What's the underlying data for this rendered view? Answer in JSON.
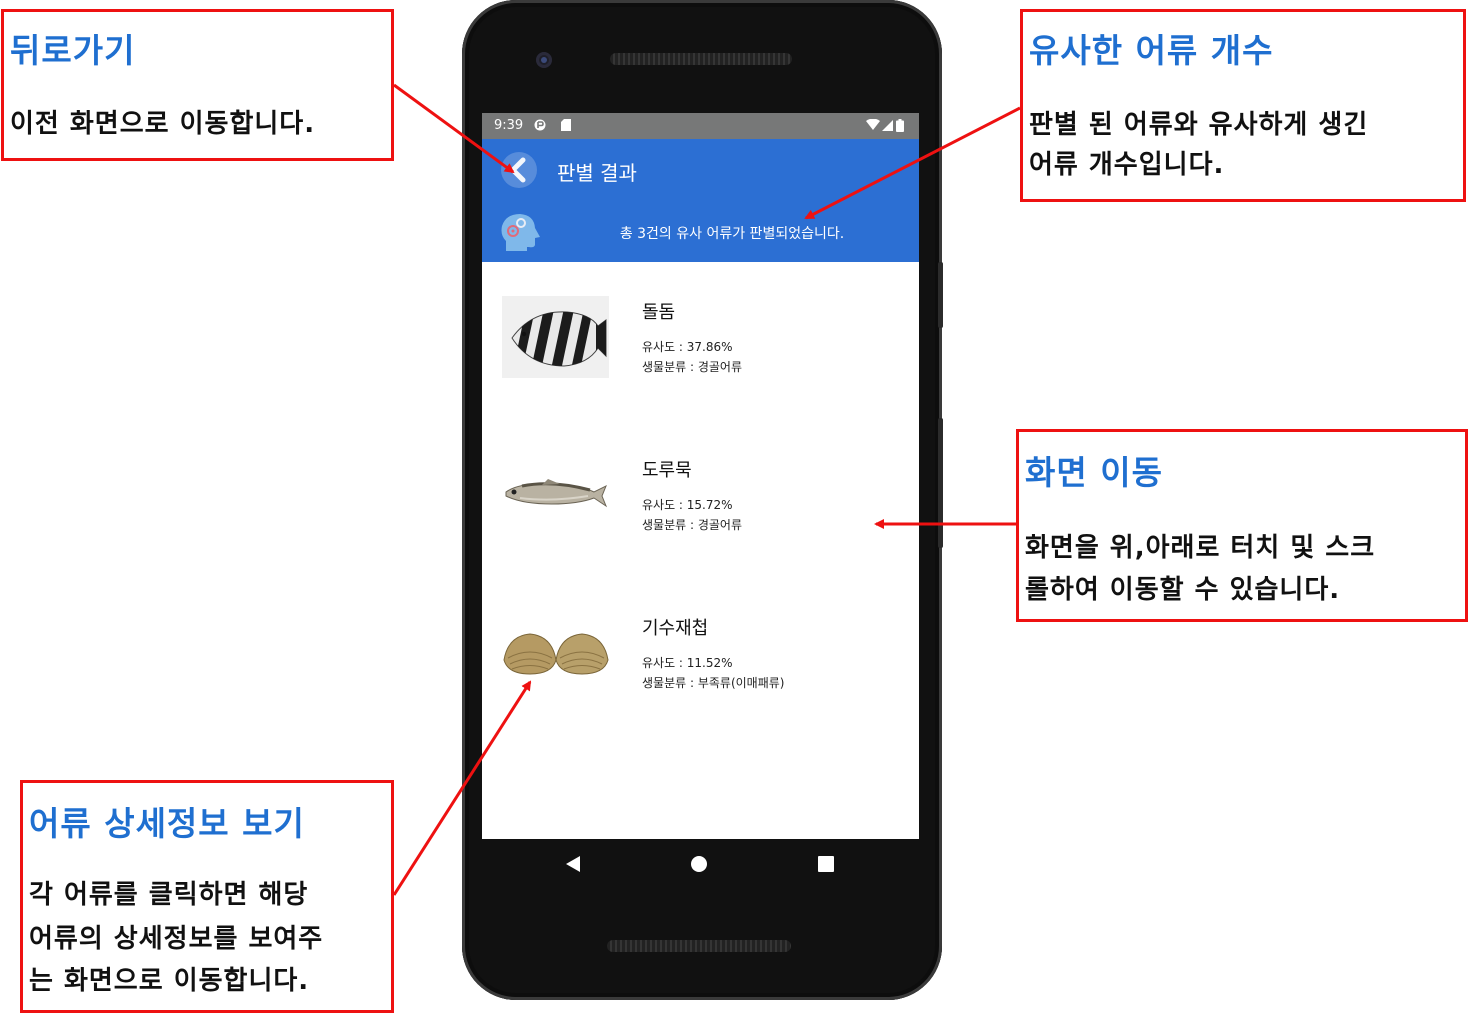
{
  "status_bar": {
    "time": "9:39"
  },
  "app_bar": {
    "title": "판별 결과",
    "result_count_text": "총 3건의 유사 어류가 판별되었습니다."
  },
  "results": [
    {
      "name": "돌돔",
      "similarity": "유사도 : 37.86%",
      "classification": "생물분류 : 경골어류",
      "image": "striped-beakfish"
    },
    {
      "name": "도루묵",
      "similarity": "유사도 : 15.72%",
      "classification": "생물분류 : 경골어류",
      "image": "sailfin-sandfish"
    },
    {
      "name": "기수재첩",
      "similarity": "유사도 : 11.52%",
      "classification": "생물분류 : 부족류(이매패류)",
      "image": "brackish-water-clam"
    }
  ],
  "nav_bar": {
    "back_icon": "triangle-back-icon",
    "home_icon": "circle-home-icon",
    "recents_icon": "square-recents-icon"
  },
  "callouts": {
    "back": {
      "title": "뒤로가기",
      "body": [
        "이전 화면으로 이동합니다."
      ]
    },
    "similar_count": {
      "title": "유사한 어류 개수",
      "body": [
        "판별 된 어류와 유사하게 생긴",
        "어류 개수입니다."
      ]
    },
    "scroll": {
      "title": "화면 이동",
      "body": [
        "화면을 위,아래로 터치 및 스크",
        "롤하여 이동할 수 있습니다."
      ]
    },
    "detail": {
      "title": "어류 상세정보 보기",
      "body": [
        "각 어류를 클릭하면 해당",
        "어류의 상세정보를 보여주",
        "는 화면으로 이동합니다."
      ]
    }
  },
  "colors": {
    "app_bar": "#2c6fd3",
    "callout_border": "#ee1111",
    "callout_title": "#1f6fd0",
    "arrow": "#ee1111"
  }
}
